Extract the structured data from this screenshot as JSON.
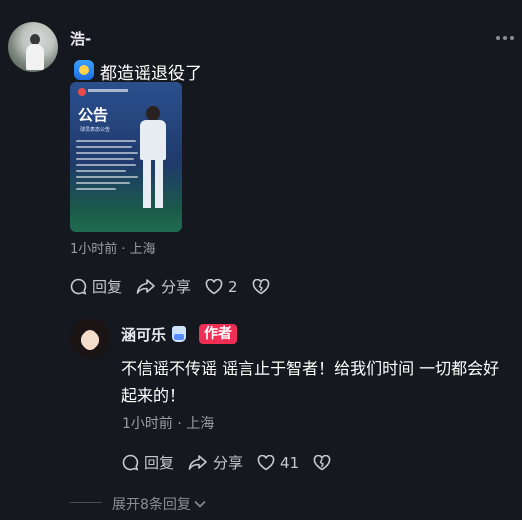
{
  "post": {
    "username": "浩-",
    "text": "都造谣退役了",
    "image": {
      "title": "公告",
      "subtitle": "球员表态公告"
    },
    "meta": "1小时前 · 上海",
    "actions": {
      "reply": "回复",
      "share": "分享",
      "likes": "2"
    }
  },
  "reply": {
    "username": "涵可乐",
    "badge": "作者",
    "text": "不信谣不传谣 谣言止于智者！给我们时间 一切都会好起来的！",
    "meta": "1小时前 · 上海",
    "actions": {
      "reply": "回复",
      "share": "分享",
      "likes": "41"
    }
  },
  "expand": {
    "label": "展开8条回复"
  },
  "colors": {
    "background": "#16181f",
    "badge": "#ef2e55",
    "meta": "#9a9ca6"
  }
}
